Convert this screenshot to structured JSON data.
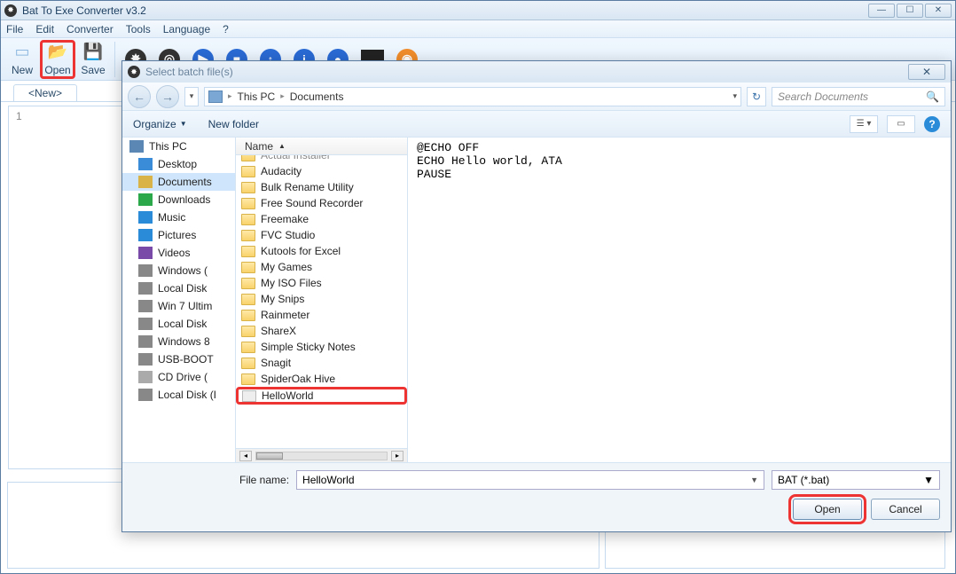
{
  "app": {
    "title": "Bat To Exe Converter v3.2"
  },
  "menu": [
    "File",
    "Edit",
    "Converter",
    "Tools",
    "Language",
    "?"
  ],
  "toolbar": {
    "new": "New",
    "open": "Open",
    "save": "Save"
  },
  "tab": {
    "label": "<New>"
  },
  "gutter_line": "1",
  "dialog": {
    "title": "Select batch file(s)",
    "breadcrumb": [
      "This PC",
      "Documents"
    ],
    "search_placeholder": "Search Documents",
    "organize": "Organize",
    "new_folder": "New folder",
    "sidebar": [
      {
        "label": "This PC",
        "icon": "pc",
        "head": true
      },
      {
        "label": "Desktop",
        "icon": "desktop"
      },
      {
        "label": "Documents",
        "icon": "docs",
        "selected": true
      },
      {
        "label": "Downloads",
        "icon": "down"
      },
      {
        "label": "Music",
        "icon": "music"
      },
      {
        "label": "Pictures",
        "icon": "pics"
      },
      {
        "label": "Videos",
        "icon": "videos"
      },
      {
        "label": "Windows (",
        "icon": "drive"
      },
      {
        "label": "Local Disk",
        "icon": "drive"
      },
      {
        "label": "Win 7 Ultim",
        "icon": "drive"
      },
      {
        "label": "Local Disk",
        "icon": "drive"
      },
      {
        "label": "Windows 8",
        "icon": "drive"
      },
      {
        "label": "USB-BOOT",
        "icon": "drive"
      },
      {
        "label": "CD Drive (",
        "icon": "cd"
      },
      {
        "label": "Local Disk (I",
        "icon": "drive"
      }
    ],
    "list_header": "Name",
    "folders": [
      "Actual Installer",
      "Audacity",
      "Bulk Rename Utility",
      "Free Sound Recorder",
      "Freemake",
      "FVC Studio",
      "Kutools for Excel",
      "My Games",
      "My ISO Files",
      "My Snips",
      "Rainmeter",
      "ShareX",
      "Simple Sticky Notes",
      "Snagit",
      "SpiderOak Hive"
    ],
    "file": "HelloWorld",
    "preview": "@ECHO OFF\nECHO Hello world, ATA\nPAUSE",
    "filename_label": "File name:",
    "filename_value": "HelloWorld",
    "filter": "BAT (*.bat)",
    "open_btn": "Open",
    "cancel_btn": "Cancel"
  }
}
